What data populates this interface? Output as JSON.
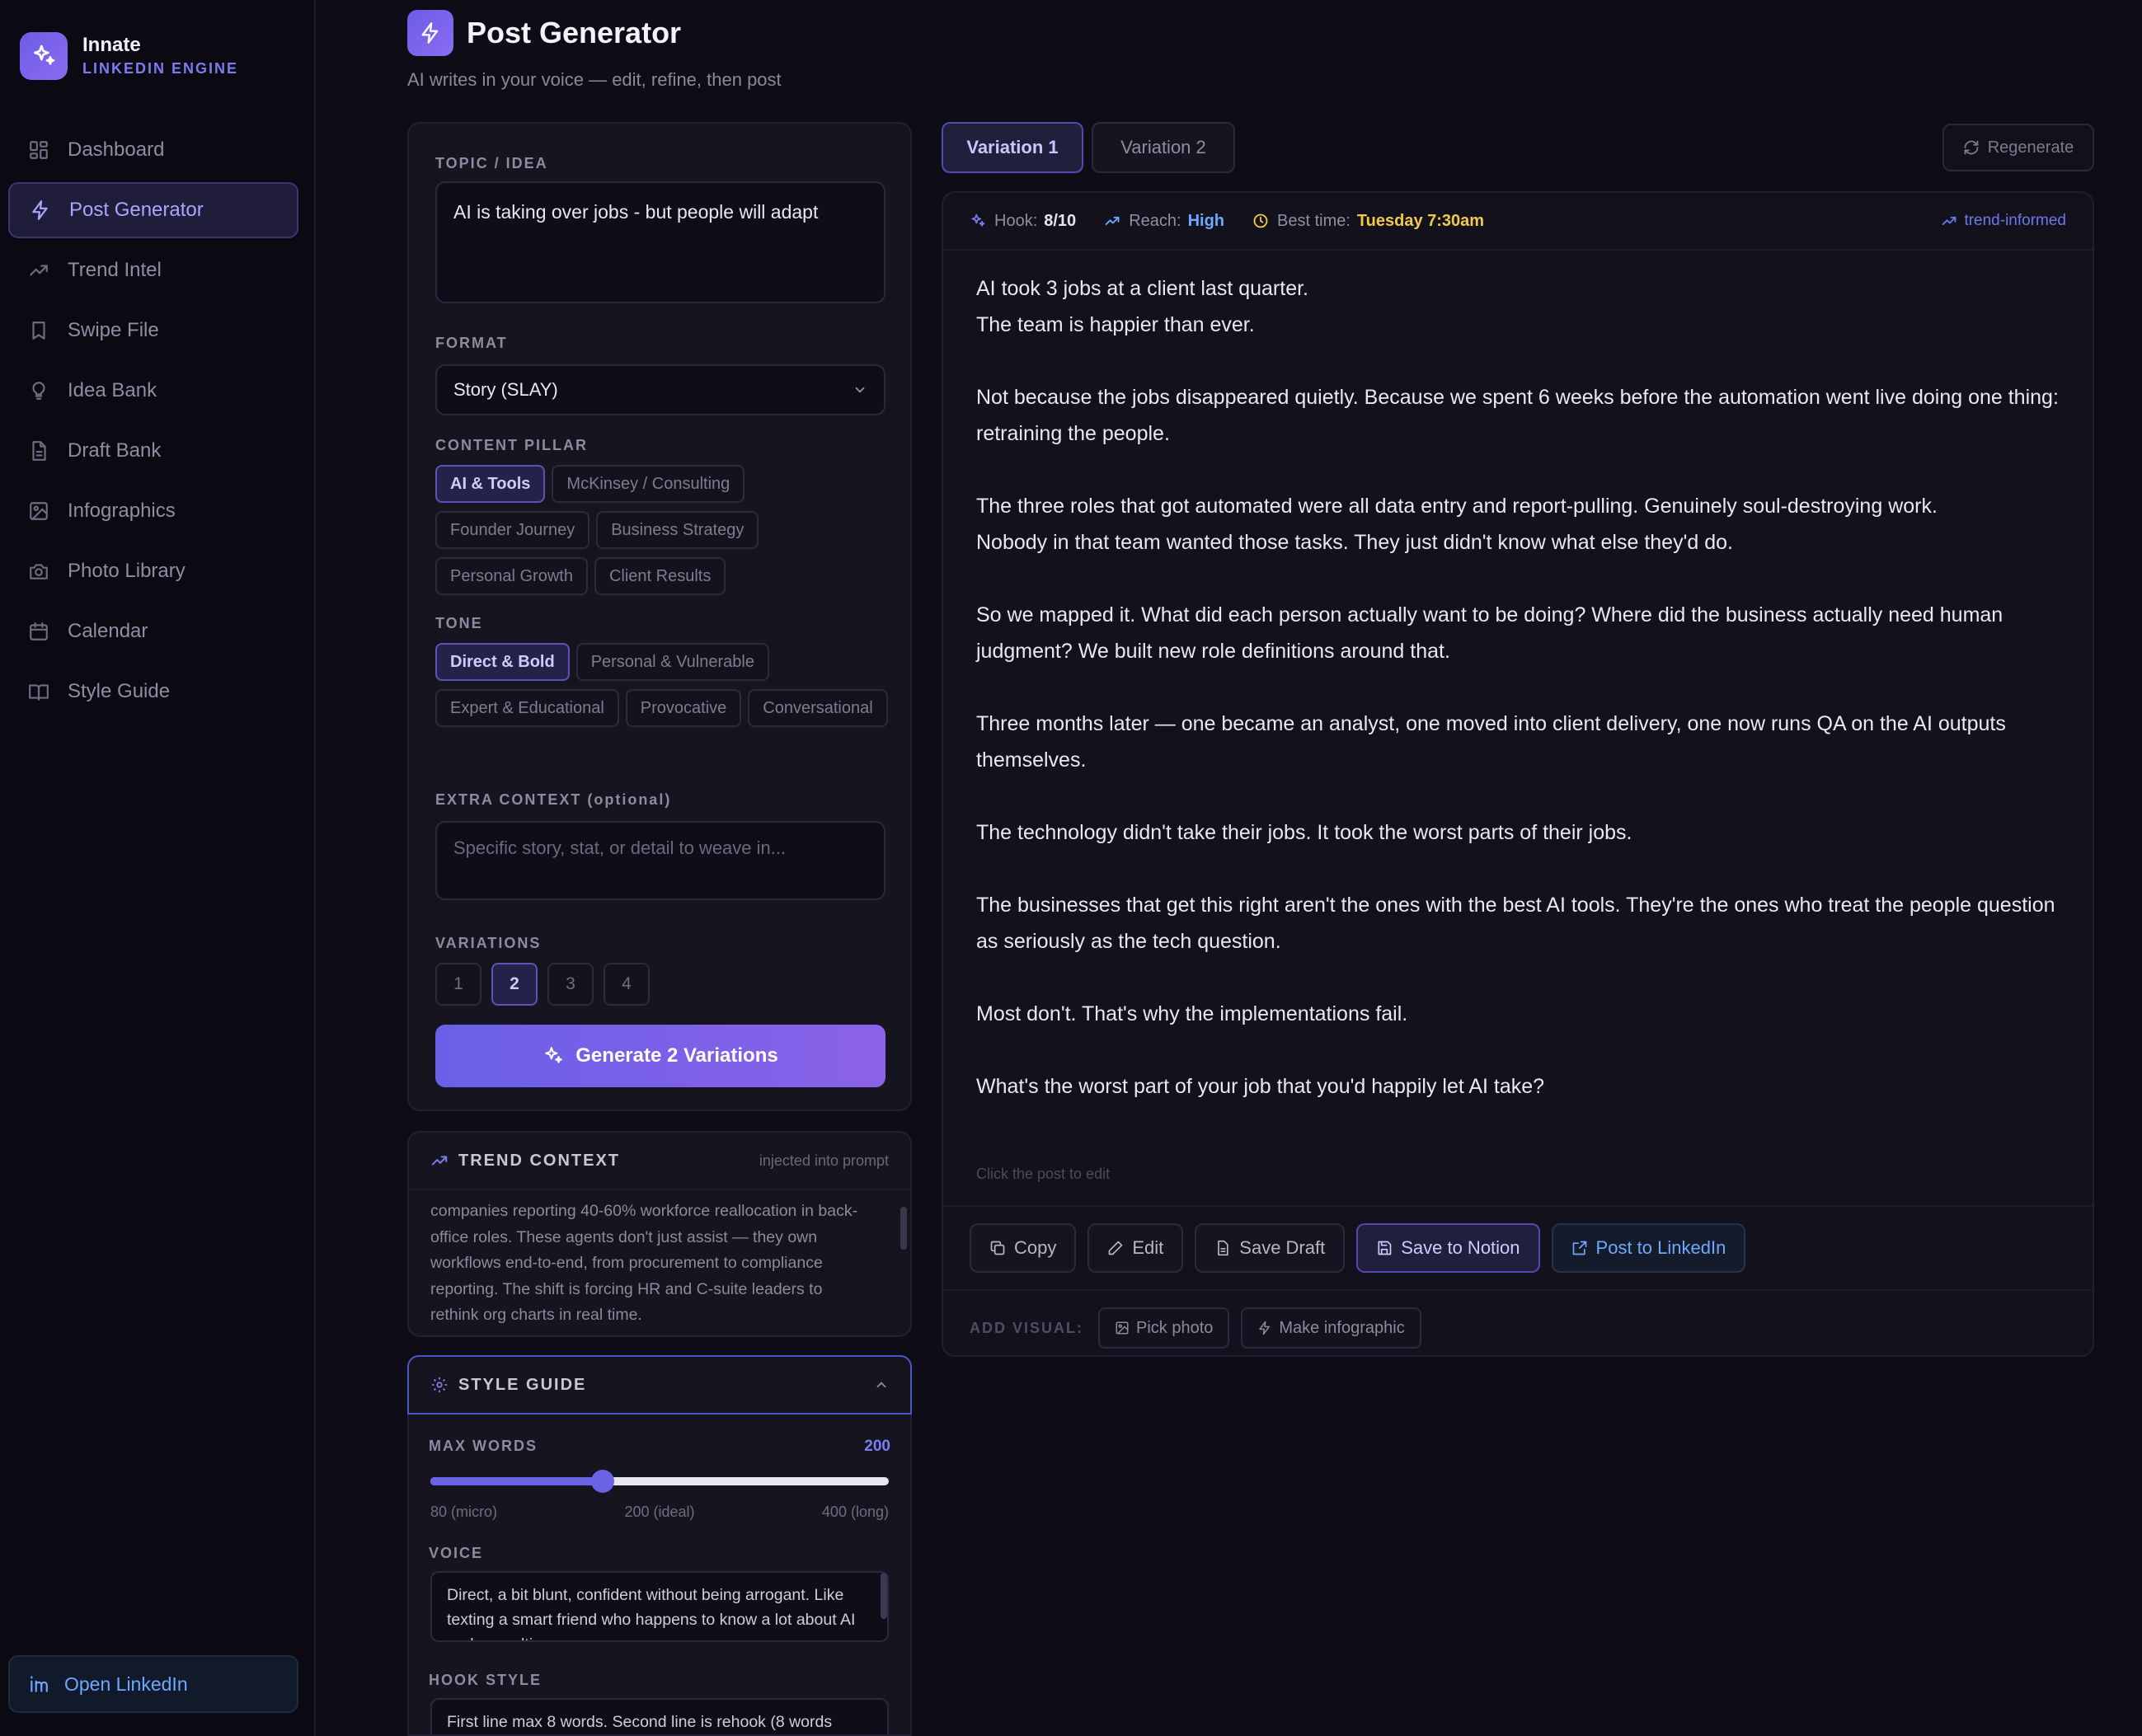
{
  "brand": {
    "name": "Innate",
    "subtitle": "LINKEDIN ENGINE"
  },
  "sidebar": {
    "items": [
      {
        "label": "Dashboard",
        "icon": "dashboard-icon"
      },
      {
        "label": "Post Generator",
        "icon": "bolt-icon",
        "active": true
      },
      {
        "label": "Trend Intel",
        "icon": "trending-icon"
      },
      {
        "label": "Swipe File",
        "icon": "bookmark-icon"
      },
      {
        "label": "Idea Bank",
        "icon": "lightbulb-icon"
      },
      {
        "label": "Draft Bank",
        "icon": "document-icon"
      },
      {
        "label": "Infographics",
        "icon": "image-icon"
      },
      {
        "label": "Photo Library",
        "icon": "camera-icon"
      },
      {
        "label": "Calendar",
        "icon": "calendar-icon"
      },
      {
        "label": "Style Guide",
        "icon": "book-icon"
      }
    ],
    "open_linkedin": "Open LinkedIn"
  },
  "header": {
    "title": "Post Generator",
    "subtitle": "AI writes in your voice — edit, refine, then post"
  },
  "form": {
    "topic_label": "TOPIC / IDEA",
    "topic_value": "AI is taking over jobs - but people will adapt",
    "format_label": "FORMAT",
    "format_value": "Story (SLAY)",
    "pillar_label": "CONTENT PILLAR",
    "pillars": [
      "AI & Tools",
      "McKinsey / Consulting",
      "Founder Journey",
      "Business Strategy",
      "Personal Growth",
      "Client Results"
    ],
    "pillar_selected": "AI & Tools",
    "tone_label": "TONE",
    "tones": [
      "Direct & Bold",
      "Personal & Vulnerable",
      "Expert & Educational",
      "Provocative",
      "Conversational"
    ],
    "tone_selected": "Direct & Bold",
    "extra_label": "EXTRA CONTEXT (optional)",
    "extra_placeholder": "Specific story, stat, or detail to weave in...",
    "variations_label": "VARIATIONS",
    "variation_options": [
      "1",
      "2",
      "3",
      "4"
    ],
    "variation_selected": "2",
    "generate_label": "Generate 2 Variations"
  },
  "trend_context": {
    "title": "TREND CONTEXT",
    "note": "injected into prompt",
    "text": "companies reporting 40-60% workforce reallocation in back-office roles. These agents don't just assist — they own workflows end-to-end, from procurement to compliance reporting. The shift is forcing HR and C-suite leaders to rethink org charts in real time."
  },
  "style_guide": {
    "title": "STYLE GUIDE",
    "max_words_label": "MAX WORDS",
    "max_words_value": "200",
    "slider": {
      "min": 80,
      "max": 400,
      "value": 200
    },
    "ticks": [
      "80 (micro)",
      "200 (ideal)",
      "400 (long)"
    ],
    "voice_label": "VOICE",
    "voice_text": "Direct, a bit blunt, confident without being arrogant. Like texting a smart friend who happens to know a lot about AI and consulting.",
    "hook_label": "HOOK STYLE",
    "hook_text": "First line max 8 words. Second line is rehook (8 words"
  },
  "variations": {
    "tabs": [
      "Variation 1",
      "Variation 2"
    ],
    "active": "Variation 1",
    "regenerate_label": "Regenerate"
  },
  "post": {
    "metrics": {
      "hook_label": "Hook:",
      "hook_value": "8/10",
      "reach_label": "Reach:",
      "reach_value": "High",
      "time_label": "Best time:",
      "time_value": "Tuesday 7:30am",
      "badge": "trend-informed"
    },
    "paragraphs": [
      "AI took 3 jobs at a client last quarter.\nThe team is happier than ever.",
      "Not because the jobs disappeared quietly. Because we spent 6 weeks before the automation went live doing one thing: retraining the people.",
      "The three roles that got automated were all data entry and report-pulling. Genuinely soul-destroying work.\nNobody in that team wanted those tasks. They just didn't know what else they'd do.",
      "So we mapped it. What did each person actually want to be doing? Where did the business actually need human judgment? We built new role definitions around that.",
      "Three months later — one became an analyst, one moved into client delivery, one now runs QA on the AI outputs themselves.",
      "The technology didn't take their jobs. It took the worst parts of their jobs.",
      "The businesses that get this right aren't the ones with the best AI tools. They're the ones who treat the people question as seriously as the tech question.",
      "Most don't. That's why the implementations fail.",
      "What's the worst part of your job that you'd happily let AI take?"
    ],
    "hint": "Click the post to edit",
    "actions": {
      "copy": "Copy",
      "edit": "Edit",
      "save_draft": "Save Draft",
      "save_notion": "Save to Notion",
      "post_linkedin": "Post to LinkedIn"
    },
    "visual": {
      "label": "ADD VISUAL:",
      "pick_photo": "Pick photo",
      "make_infographic": "Make infographic"
    }
  },
  "colors": {
    "accent": "#6c5ce7",
    "background": "#0e0d17",
    "panel": "#15141f",
    "highlight_time": "#f2c94c",
    "reach": "#6fa8ff"
  }
}
